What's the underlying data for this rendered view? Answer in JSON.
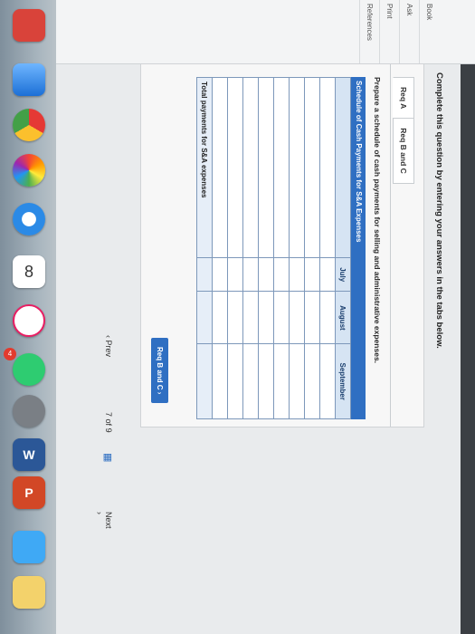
{
  "question": {
    "instruction": "Complete this question by entering your answers in the tabs below.",
    "tabs": [
      {
        "label": "Req A"
      },
      {
        "label": "Req B and C"
      }
    ],
    "prompt": "Prepare a schedule of cash payments for selling and administrative expenses.",
    "schedule_title": "Schedule of Cash Payments for S&A Expenses",
    "columns": [
      "",
      "July",
      "August",
      "September"
    ],
    "rows": [
      {
        "label": ""
      },
      {
        "label": ""
      },
      {
        "label": ""
      },
      {
        "label": ""
      },
      {
        "label": ""
      },
      {
        "label": ""
      },
      {
        "label": ""
      },
      {
        "label": ""
      }
    ],
    "total_label": "Total payments for S&A expenses",
    "next_step_button": "Req B and C ›"
  },
  "rail": {
    "items": [
      "Book",
      "Ask",
      "Print",
      "References"
    ]
  },
  "nav": {
    "prev": "‹ Prev",
    "pager_current": "7",
    "pager_of": "of",
    "pager_total": "9",
    "next": "Next ›"
  },
  "dock": {
    "badges": [
      "4"
    ],
    "app_label": "8"
  }
}
